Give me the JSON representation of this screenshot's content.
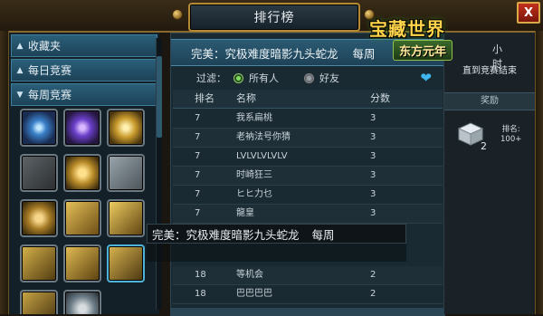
{
  "window": {
    "title": "排行榜",
    "close_label": "X"
  },
  "sidebar": {
    "items": [
      {
        "label": "收藏夹",
        "expanded": false
      },
      {
        "label": "每日竞赛",
        "expanded": false
      },
      {
        "label": "每周竞赛",
        "expanded": true
      }
    ],
    "icons": [
      "blue-orb-icon",
      "purple-crest-icon",
      "gold-wings-icon",
      "gray-pistol-icon",
      "xp-badge-icon",
      "silver-castle-icon",
      "gold-fist-icon",
      "gold-truck-icon",
      "gold-chest-icon",
      "gold-tank-icon",
      "gold-robot-icon",
      "gold-creature-icon",
      "gold-swirl-icon",
      "xp-wings-icon"
    ]
  },
  "event": {
    "part1": "完美：究极难度暗影九头蛇龙",
    "part2": "每周"
  },
  "filter": {
    "label": "过滤：",
    "option_all": "所有人",
    "option_friends": "好友",
    "selected": "所有人"
  },
  "table": {
    "headers": {
      "rank": "排名",
      "name": "名称",
      "score": "分数"
    },
    "rows": [
      {
        "rank": "7",
        "name": "我系扁桃",
        "score": "3"
      },
      {
        "rank": "7",
        "name": "老衲法号你猜",
        "score": "3"
      },
      {
        "rank": "7",
        "name": "LVLVLVLVLV",
        "score": "3"
      },
      {
        "rank": "7",
        "name": "时崎狂三",
        "score": "3"
      },
      {
        "rank": "7",
        "name": "ヒヒ力乜",
        "score": "3"
      },
      {
        "rank": "7",
        "name": "龍皇",
        "score": "3"
      },
      {
        "rank": "18",
        "name": "等机会",
        "score": "2"
      },
      {
        "rank": "18",
        "name": "巴巴巴巴",
        "score": "2"
      }
    ]
  },
  "logo": {
    "title": "宝藏世界",
    "subtitle": "东方元年"
  },
  "right_panel": {
    "hours_label": "小时",
    "countdown_text": "直到竞赛结束",
    "reward_header": "奖励",
    "reward_count": "2",
    "reward_rank_label": "排名:",
    "reward_rank_value": "100+"
  },
  "tooltip": {
    "part1": "完美：究极难度暗影九头蛇龙",
    "part2": "每周"
  },
  "colors": {
    "accent_blue": "#2b5a72",
    "frame_gold": "#b48a35",
    "heart": "#3fb6ee",
    "radio_on": "#7fe25f"
  }
}
